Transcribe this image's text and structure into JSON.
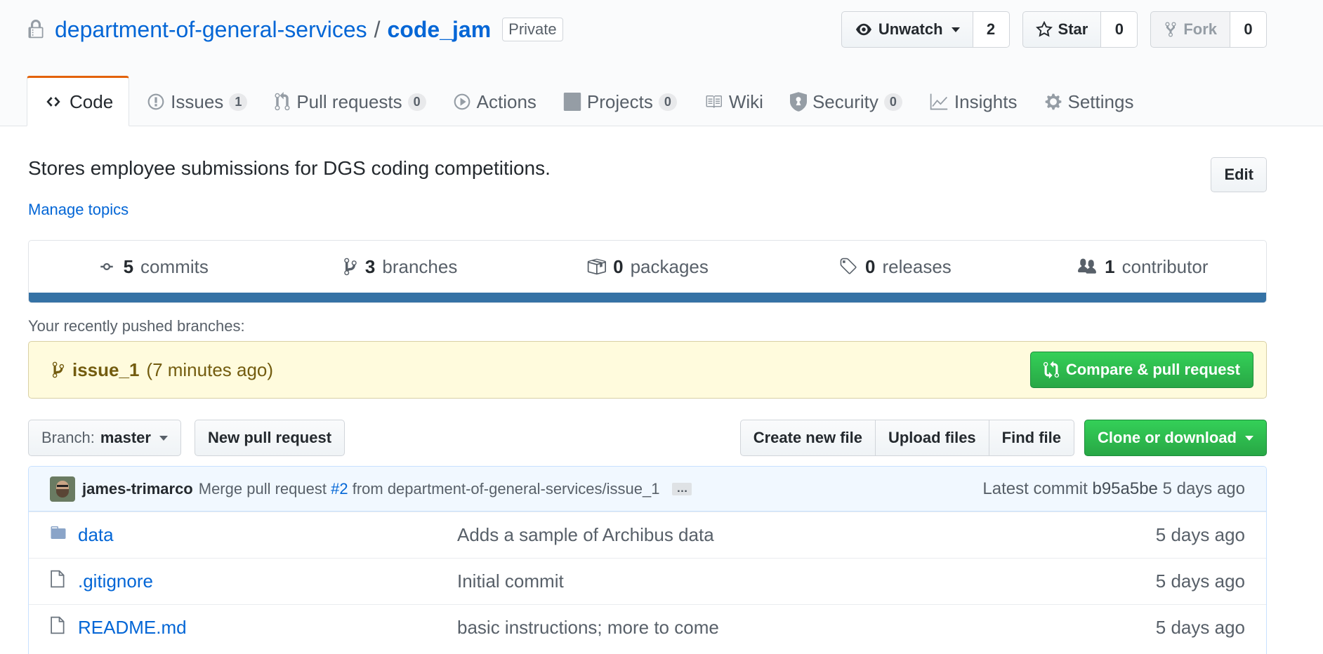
{
  "repo": {
    "owner": "department-of-general-services",
    "separator": "/",
    "name": "code_jam",
    "visibility": "Private"
  },
  "actions": {
    "unwatch_label": "Unwatch",
    "watch_count": "2",
    "star_label": "Star",
    "star_count": "0",
    "fork_label": "Fork",
    "fork_count": "0"
  },
  "nav": {
    "code": "Code",
    "issues": "Issues",
    "issues_count": "1",
    "pull_requests": "Pull requests",
    "pull_requests_count": "0",
    "actions": "Actions",
    "projects": "Projects",
    "projects_count": "0",
    "wiki": "Wiki",
    "security": "Security",
    "security_count": "0",
    "insights": "Insights",
    "settings": "Settings"
  },
  "about": {
    "description": "Stores employee submissions for DGS coding competitions.",
    "manage_topics": "Manage topics",
    "edit_label": "Edit"
  },
  "summary": {
    "commits_count": "5",
    "commits_label": "commits",
    "branches_count": "3",
    "branches_label": "branches",
    "packages_count": "0",
    "packages_label": "packages",
    "releases_count": "0",
    "releases_label": "releases",
    "contributors_count": "1",
    "contributors_label": "contributor",
    "language_color": "#3572a5"
  },
  "recent": {
    "label": "Your recently pushed branches:",
    "branch": "issue_1",
    "time": "(7 minutes ago)",
    "compare_label": "Compare & pull request"
  },
  "file_nav": {
    "branch_prefix": "Branch:",
    "branch_name": "master",
    "new_pr": "New pull request",
    "create_file": "Create new file",
    "upload_files": "Upload files",
    "find_file": "Find file",
    "clone": "Clone or download"
  },
  "commit": {
    "author": "james-trimarco",
    "message_prefix": "Merge pull request",
    "pr_link": "#2",
    "message_suffix": "from department-of-general-services/issue_1",
    "ellipsis": "…",
    "latest_label": "Latest commit",
    "sha": "b95a5be",
    "age": "5 days ago"
  },
  "files": [
    {
      "name": "data",
      "type": "folder-icon",
      "message": "Adds a sample of Archibus data",
      "age": "5 days ago"
    },
    {
      "name": ".gitignore",
      "type": "file-icon",
      "message": "Initial commit",
      "age": "5 days ago"
    },
    {
      "name": "README.md",
      "type": "file-icon",
      "message": "basic instructions; more to come",
      "age": "5 days ago"
    }
  ]
}
